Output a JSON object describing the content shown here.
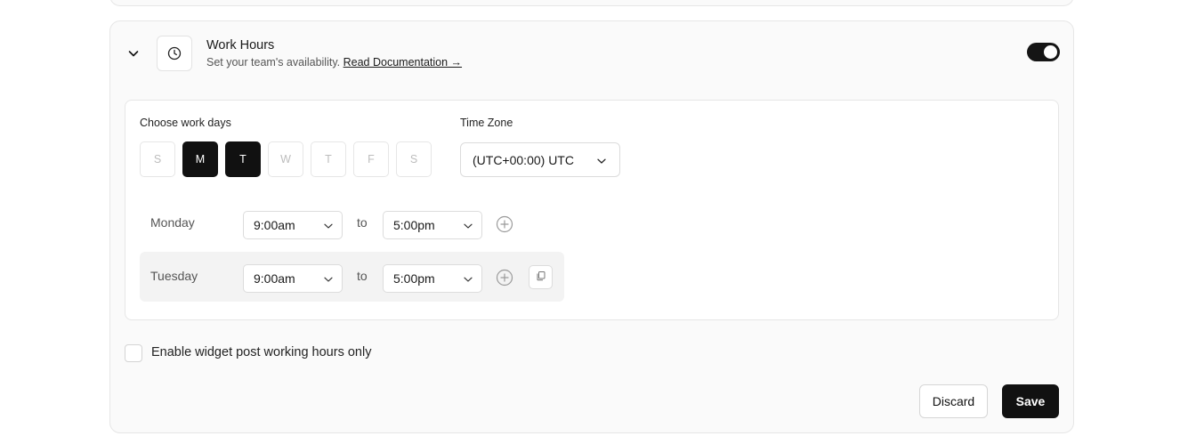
{
  "header": {
    "title": "Work Hours",
    "subtitle": "Set your team's availability.",
    "doc_link": "Read Documentation →",
    "toggle_enabled": true
  },
  "work_days": {
    "label": "Choose work days",
    "days": [
      {
        "letter": "S",
        "active": false
      },
      {
        "letter": "M",
        "active": true
      },
      {
        "letter": "T",
        "active": true
      },
      {
        "letter": "W",
        "active": false
      },
      {
        "letter": "T",
        "active": false
      },
      {
        "letter": "F",
        "active": false
      },
      {
        "letter": "S",
        "active": false
      }
    ]
  },
  "timezone": {
    "label": "Time Zone",
    "value": "(UTC+00:00) UTC"
  },
  "schedule": [
    {
      "day": "Monday",
      "start": "9:00am",
      "separator": "to",
      "end": "5:00pm"
    },
    {
      "day": "Tuesday",
      "start": "9:00am",
      "separator": "to",
      "end": "5:00pm"
    }
  ],
  "widget_option": {
    "label": "Enable widget post working hours only",
    "checked": false
  },
  "actions": {
    "discard": "Discard",
    "save": "Save"
  },
  "colors": {
    "accent": "#111111",
    "card_bg": "#fafafa",
    "border": "#e6e6e6",
    "muted_text": "#555555"
  },
  "icons": {
    "collapse": "chevron-down-icon",
    "section": "clock-icon",
    "add": "plus-circle-icon",
    "copy": "copy-icon",
    "dropdown": "chevron-down-icon"
  }
}
